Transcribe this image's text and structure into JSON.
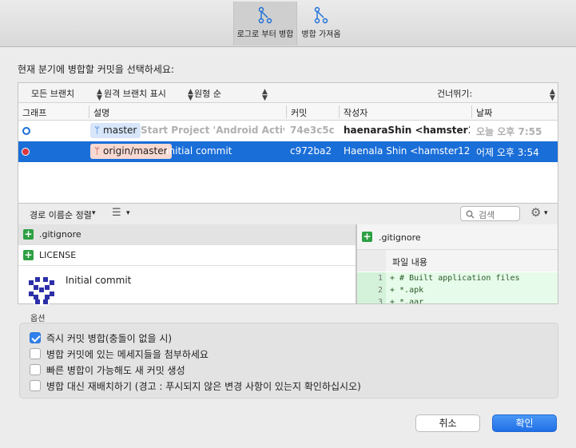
{
  "toolbar": {
    "merge_label": "로그로 부터 병합",
    "pull_label": "병합 가져옴"
  },
  "prompt": "현재 분기에 병합할 커밋을 선택하세요:",
  "filters": {
    "branches": "모든 브랜치",
    "remote": "원격 브랜치 표시",
    "order": "원형 순",
    "skip": "건너뛰기:"
  },
  "columns": {
    "graph": "그래프",
    "description": "설명",
    "commit": "커밋",
    "author": "작성자",
    "date": "날짜"
  },
  "commits": [
    {
      "branch_tag": "master",
      "message": "Start Project 'Android Activi…",
      "hash": "74e3c5c",
      "author": "haenaraShin <hamster1…",
      "date": "오늘 오후 7:55",
      "selected": false
    },
    {
      "branch_tag": "origin/master",
      "message": "Initial commit",
      "hash": "c972ba2",
      "author": "Haenala Shin <hamster12…",
      "date": "어제 오후 3:54",
      "selected": true
    }
  ],
  "files_bar": {
    "sort_label": "경로 이름순 정렬",
    "search_placeholder": "검색"
  },
  "files": [
    {
      "name": ".gitignore",
      "status": "added"
    },
    {
      "name": "LICENSE",
      "status": "added"
    }
  ],
  "commit_detail": {
    "message": "Initial commit"
  },
  "diff": {
    "file": ".gitignore",
    "hunk_label": "파일 내용",
    "lines": [
      {
        "num": "1",
        "text": "+ # Built application files"
      },
      {
        "num": "2",
        "text": "+ *.apk"
      },
      {
        "num": "3",
        "text": "+ *.aar"
      }
    ]
  },
  "options": {
    "label": "옵션",
    "items": [
      {
        "label": "즉시 커밋 병합(충돌이 없을 시)",
        "checked": true
      },
      {
        "label": "병합 커밋에 있는 메세지들을 첨부하세요",
        "checked": false
      },
      {
        "label": "빠른 병합이 가능해도 새 커밋 생성",
        "checked": false
      },
      {
        "label": "병합 대신 재배치하기 (경고 : 푸시되지 않은 변경 사항이 있는지 확인하십시오)",
        "checked": false
      }
    ]
  },
  "buttons": {
    "cancel": "취소",
    "ok": "확인"
  },
  "colors": {
    "selection": "#1a6ed8",
    "primary_button": "#2f80ed",
    "added": "#2ea043"
  }
}
